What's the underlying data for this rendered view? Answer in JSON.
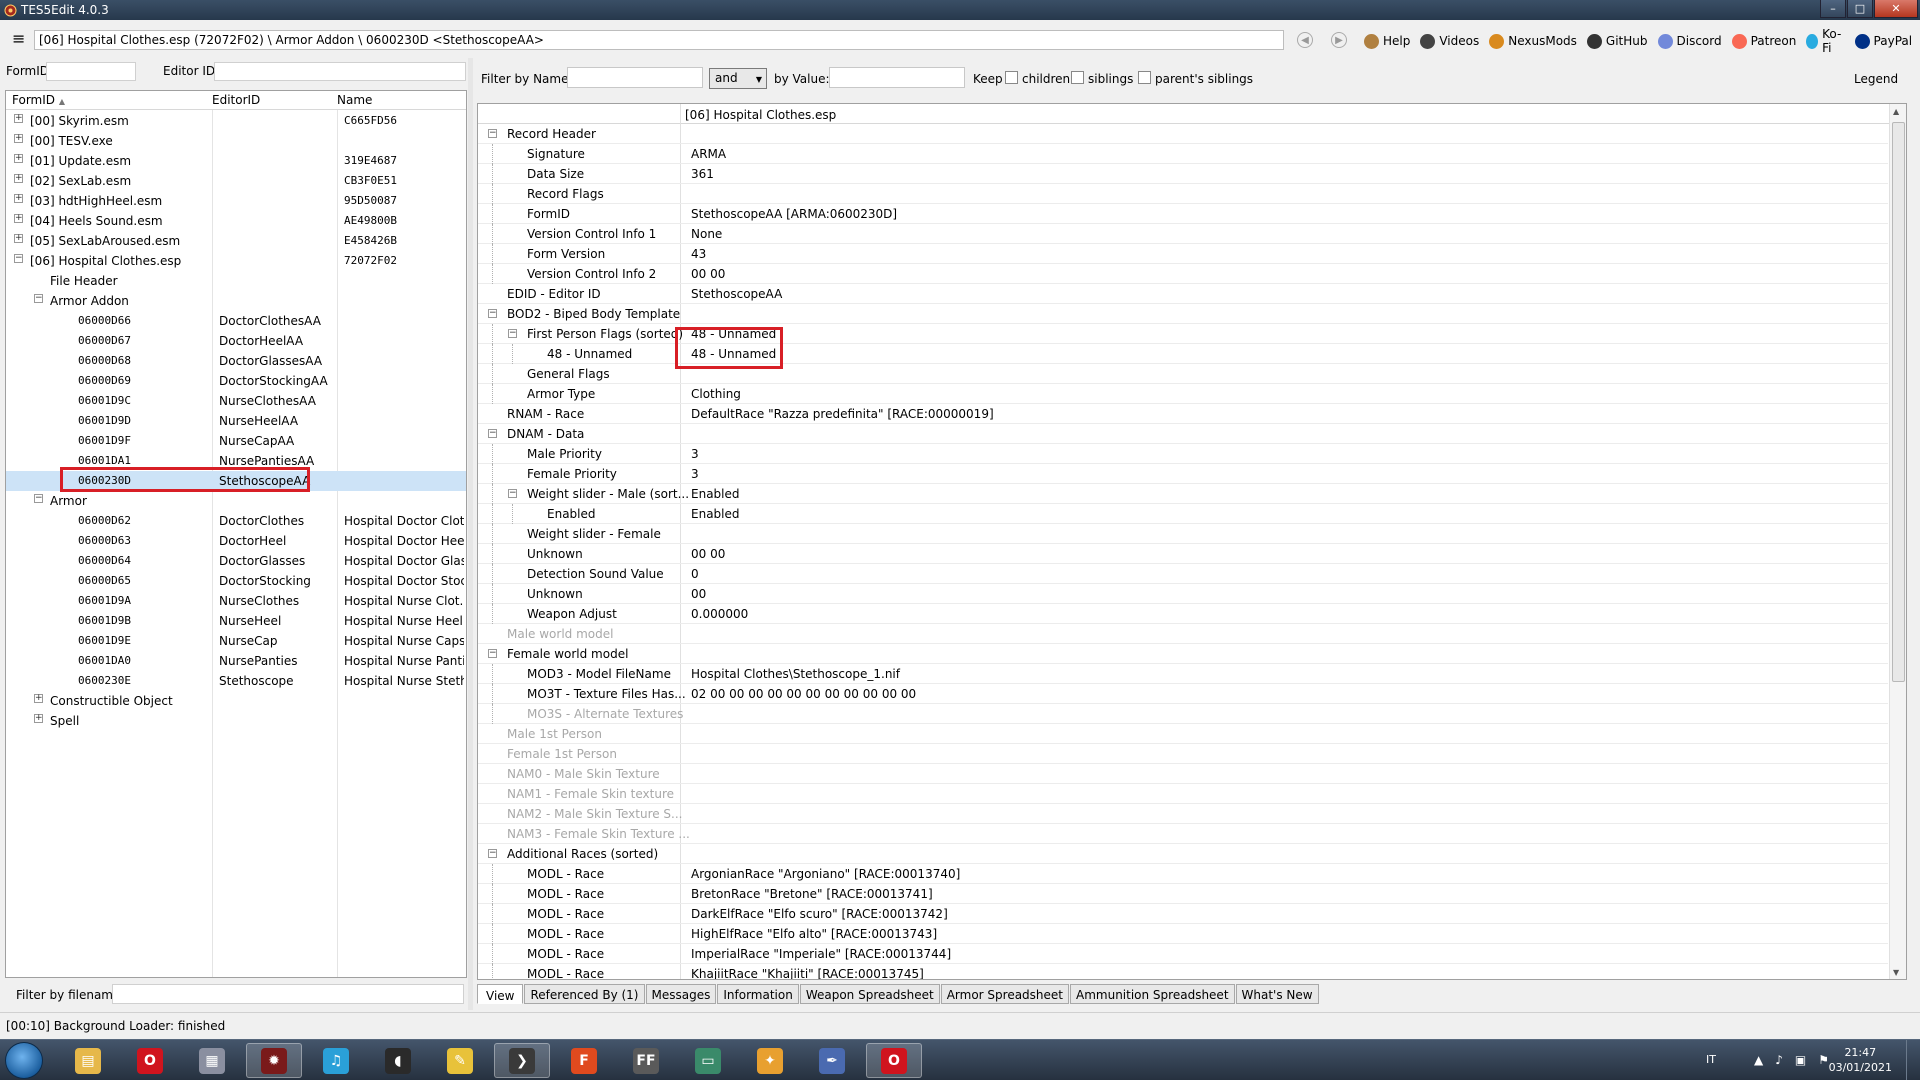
{
  "window": {
    "title": "TES5Edit 4.0.3",
    "min": "–",
    "max": "□",
    "close": "✕"
  },
  "path": {
    "text": "[06] Hospital Clothes.esp (72072F02) \\ Armor Addon \\ 0600230D <StethoscopeAA>"
  },
  "toplinks": [
    {
      "label": "Help",
      "icon": "book-icon",
      "color": "#b08040"
    },
    {
      "label": "Videos",
      "icon": "film-reel-icon",
      "color": "#444444"
    },
    {
      "label": "NexusMods",
      "icon": "nexus-icon",
      "color": "#d98a1e"
    },
    {
      "label": "GitHub",
      "icon": "octocat-icon",
      "color": "#333333"
    },
    {
      "label": "Discord",
      "icon": "discord-icon",
      "color": "#7289da"
    },
    {
      "label": "Patreon",
      "icon": "patreon-icon",
      "color": "#f96854"
    },
    {
      "label": "Ko-Fi",
      "icon": "kofi-icon",
      "color": "#29abe0"
    },
    {
      "label": "PayPal",
      "icon": "paypal-icon",
      "color": "#003087"
    }
  ],
  "left_filter": {
    "formid_label": "FormID",
    "editorid_label": "Editor ID"
  },
  "left_tree": {
    "headers": {
      "formid": "FormID",
      "editorid": "EditorID",
      "name": "Name"
    },
    "rows": [
      {
        "indent": 0,
        "exp": "+",
        "c1": "[00] Skyrim.esm",
        "c2": "",
        "c3": "C665FD56"
      },
      {
        "indent": 0,
        "exp": "+",
        "c1": "[00] TESV.exe",
        "c2": "",
        "c3": ""
      },
      {
        "indent": 0,
        "exp": "+",
        "c1": "[01] Update.esm",
        "c2": "",
        "c3": "319E4687"
      },
      {
        "indent": 0,
        "exp": "+",
        "c1": "[02] SexLab.esm",
        "c2": "",
        "c3": "CB3F0E51"
      },
      {
        "indent": 0,
        "exp": "+",
        "c1": "[03] hdtHighHeel.esm",
        "c2": "",
        "c3": "95D50087"
      },
      {
        "indent": 0,
        "exp": "+",
        "c1": "[04] Heels Sound.esm",
        "c2": "",
        "c3": "AE49800B"
      },
      {
        "indent": 0,
        "exp": "+",
        "c1": "[05] SexLabAroused.esm",
        "c2": "",
        "c3": "E458426B"
      },
      {
        "indent": 0,
        "exp": "−",
        "c1": "[06] Hospital Clothes.esp",
        "c2": "",
        "c3": "72072F02"
      },
      {
        "indent": 1,
        "exp": "",
        "c1": "File Header",
        "c2": "",
        "c3": ""
      },
      {
        "indent": 1,
        "exp": "−",
        "c1": "Armor Addon",
        "c2": "",
        "c3": ""
      },
      {
        "indent": 2,
        "exp": "",
        "c1": "06000D66",
        "c2": "DoctorClothesAA",
        "c3": "",
        "mono": true
      },
      {
        "indent": 2,
        "exp": "",
        "c1": "06000D67",
        "c2": "DoctorHeelAA",
        "c3": "",
        "mono": true
      },
      {
        "indent": 2,
        "exp": "",
        "c1": "06000D68",
        "c2": "DoctorGlassesAA",
        "c3": "",
        "mono": true
      },
      {
        "indent": 2,
        "exp": "",
        "c1": "06000D69",
        "c2": "DoctorStockingAA",
        "c3": "",
        "mono": true
      },
      {
        "indent": 2,
        "exp": "",
        "c1": "06001D9C",
        "c2": "NurseClothesAA",
        "c3": "",
        "mono": true
      },
      {
        "indent": 2,
        "exp": "",
        "c1": "06001D9D",
        "c2": "NurseHeelAA",
        "c3": "",
        "mono": true
      },
      {
        "indent": 2,
        "exp": "",
        "c1": "06001D9F",
        "c2": "NurseCapAA",
        "c3": "",
        "mono": true
      },
      {
        "indent": 2,
        "exp": "",
        "c1": "06001DA1",
        "c2": "NursePantiesAA",
        "c3": "",
        "mono": true
      },
      {
        "indent": 2,
        "exp": "",
        "c1": "0600230D",
        "c2": "StethoscopeAA",
        "c3": "",
        "mono": true,
        "selected": true
      },
      {
        "indent": 1,
        "exp": "−",
        "c1": "Armor",
        "c2": "",
        "c3": ""
      },
      {
        "indent": 2,
        "exp": "",
        "c1": "06000D62",
        "c2": "DoctorClothes",
        "c3": "Hospital Doctor Clot...",
        "mono": true
      },
      {
        "indent": 2,
        "exp": "",
        "c1": "06000D63",
        "c2": "DoctorHeel",
        "c3": "Hospital Doctor Heel",
        "mono": true
      },
      {
        "indent": 2,
        "exp": "",
        "c1": "06000D64",
        "c2": "DoctorGlasses",
        "c3": "Hospital Doctor Glas...",
        "mono": true
      },
      {
        "indent": 2,
        "exp": "",
        "c1": "06000D65",
        "c2": "DoctorStocking",
        "c3": "Hospital Doctor Stoc...",
        "mono": true
      },
      {
        "indent": 2,
        "exp": "",
        "c1": "06001D9A",
        "c2": "NurseClothes",
        "c3": "Hospital Nurse Clot...",
        "mono": true
      },
      {
        "indent": 2,
        "exp": "",
        "c1": "06001D9B",
        "c2": "NurseHeel",
        "c3": "Hospital Nurse Heel",
        "mono": true
      },
      {
        "indent": 2,
        "exp": "",
        "c1": "06001D9E",
        "c2": "NurseCap",
        "c3": "Hospital Nurse Caps",
        "mono": true
      },
      {
        "indent": 2,
        "exp": "",
        "c1": "06001DA0",
        "c2": "NursePanties",
        "c3": "Hospital Nurse Panti...",
        "mono": true
      },
      {
        "indent": 2,
        "exp": "",
        "c1": "0600230E",
        "c2": "Stethoscope",
        "c3": "Hospital Nurse Steth...",
        "mono": true
      },
      {
        "indent": 1,
        "exp": "+",
        "c1": "Constructible Object",
        "c2": "",
        "c3": ""
      },
      {
        "indent": 1,
        "exp": "+",
        "c1": "Spell",
        "c2": "",
        "c3": ""
      }
    ]
  },
  "left_bottom": {
    "label": "Filter by filename:"
  },
  "right_filter": {
    "filter_name_label": "Filter by Name:",
    "and_value": "and",
    "by_value_label": "by Value:",
    "keep_label": "Keep",
    "children_label": "children",
    "siblings_label": "siblings",
    "parents_siblings_label": "parent's siblings",
    "legend_label": "Legend"
  },
  "record": {
    "header": "[06] Hospital Clothes.esp",
    "rows": [
      {
        "lvl": 0,
        "exp": "−",
        "label": "Record Header",
        "value": ""
      },
      {
        "lvl": 1,
        "exp": "",
        "label": "Signature",
        "value": "ARMA"
      },
      {
        "lvl": 1,
        "exp": "",
        "label": "Data Size",
        "value": "361"
      },
      {
        "lvl": 1,
        "exp": "",
        "label": "Record Flags",
        "value": ""
      },
      {
        "lvl": 1,
        "exp": "",
        "label": "FormID",
        "value": "StethoscopeAA [ARMA:0600230D]"
      },
      {
        "lvl": 1,
        "exp": "",
        "label": "Version Control Info 1",
        "value": "None"
      },
      {
        "lvl": 1,
        "exp": "",
        "label": "Form Version",
        "value": "43"
      },
      {
        "lvl": 1,
        "exp": "",
        "label": "Version Control Info 2",
        "value": "00 00"
      },
      {
        "lvl": 0,
        "exp": "",
        "label": "EDID - Editor ID",
        "value": "StethoscopeAA"
      },
      {
        "lvl": 0,
        "exp": "−",
        "label": "BOD2 - Biped Body Template",
        "value": ""
      },
      {
        "lvl": 1,
        "exp": "−",
        "label": "First Person Flags (sorted)",
        "value": "48 - Unnamed"
      },
      {
        "lvl": 2,
        "exp": "",
        "label": "48 - Unnamed",
        "value": "48 - Unnamed"
      },
      {
        "lvl": 1,
        "exp": "",
        "label": "General Flags",
        "value": ""
      },
      {
        "lvl": 1,
        "exp": "",
        "label": "Armor Type",
        "value": "Clothing"
      },
      {
        "lvl": 0,
        "exp": "",
        "label": "RNAM - Race",
        "value": "DefaultRace \"Razza predefinita\" [RACE:00000019]"
      },
      {
        "lvl": 0,
        "exp": "−",
        "label": "DNAM - Data",
        "value": ""
      },
      {
        "lvl": 1,
        "exp": "",
        "label": "Male Priority",
        "value": "3"
      },
      {
        "lvl": 1,
        "exp": "",
        "label": "Female Priority",
        "value": "3"
      },
      {
        "lvl": 1,
        "exp": "−",
        "label": "Weight slider - Male (sort...",
        "value": "Enabled"
      },
      {
        "lvl": 2,
        "exp": "",
        "label": "Enabled",
        "value": "Enabled"
      },
      {
        "lvl": 1,
        "exp": "",
        "label": "Weight slider - Female",
        "value": ""
      },
      {
        "lvl": 1,
        "exp": "",
        "label": "Unknown",
        "value": "00 00"
      },
      {
        "lvl": 1,
        "exp": "",
        "label": "Detection Sound Value",
        "value": "0"
      },
      {
        "lvl": 1,
        "exp": "",
        "label": "Unknown",
        "value": "00"
      },
      {
        "lvl": 1,
        "exp": "",
        "label": "Weapon Adjust",
        "value": "0.000000"
      },
      {
        "lvl": 0,
        "exp": "",
        "label": "Male world model",
        "value": "",
        "dim": true
      },
      {
        "lvl": 0,
        "exp": "−",
        "label": "Female world model",
        "value": ""
      },
      {
        "lvl": 1,
        "exp": "",
        "label": "MOD3 - Model FileName",
        "value": "Hospital Clothes\\Stethoscope_1.nif"
      },
      {
        "lvl": 1,
        "exp": "",
        "label": "MO3T - Texture Files Has...",
        "value": "02 00 00 00 00 00 00 00 00 00 00 00"
      },
      {
        "lvl": 1,
        "exp": "",
        "label": "MO3S - Alternate Textures",
        "value": "",
        "dim": true
      },
      {
        "lvl": 0,
        "exp": "",
        "label": "Male 1st Person",
        "value": "",
        "dim": true
      },
      {
        "lvl": 0,
        "exp": "",
        "label": "Female 1st Person",
        "value": "",
        "dim": true
      },
      {
        "lvl": 0,
        "exp": "",
        "label": "NAM0 - Male Skin Texture",
        "value": "",
        "dim": true
      },
      {
        "lvl": 0,
        "exp": "",
        "label": "NAM1 - Female Skin texture",
        "value": "",
        "dim": true
      },
      {
        "lvl": 0,
        "exp": "",
        "label": "NAM2 - Male Skin Texture S...",
        "value": "",
        "dim": true
      },
      {
        "lvl": 0,
        "exp": "",
        "label": "NAM3 - Female Skin Texture ...",
        "value": "",
        "dim": true
      },
      {
        "lvl": 0,
        "exp": "−",
        "label": "Additional Races (sorted)",
        "value": ""
      },
      {
        "lvl": 1,
        "exp": "",
        "label": "MODL - Race",
        "value": "ArgonianRace \"Argoniano\" [RACE:00013740]"
      },
      {
        "lvl": 1,
        "exp": "",
        "label": "MODL - Race",
        "value": "BretonRace \"Bretone\" [RACE:00013741]"
      },
      {
        "lvl": 1,
        "exp": "",
        "label": "MODL - Race",
        "value": "DarkElfRace \"Elfo scuro\" [RACE:00013742]"
      },
      {
        "lvl": 1,
        "exp": "",
        "label": "MODL - Race",
        "value": "HighElfRace \"Elfo alto\" [RACE:00013743]"
      },
      {
        "lvl": 1,
        "exp": "",
        "label": "MODL - Race",
        "value": "ImperialRace \"Imperiale\" [RACE:00013744]"
      },
      {
        "lvl": 1,
        "exp": "",
        "label": "MODL - Race",
        "value": "KhajiitRace \"Khajiiti\" [RACE:00013745]"
      }
    ]
  },
  "tabs": [
    "View",
    "Referenced By (1)",
    "Messages",
    "Information",
    "Weapon Spreadsheet",
    "Armor Spreadsheet",
    "Ammunition Spreadsheet",
    "What's New"
  ],
  "status": {
    "text": "[00:10] Background Loader: finished"
  },
  "taskbar": {
    "apps": [
      {
        "icon": "explorer-folder-icon",
        "glyph": "▤",
        "color": "#e6b84a"
      },
      {
        "icon": "opera-icon",
        "glyph": "O",
        "color": "#d0141e"
      },
      {
        "icon": "calculator-icon",
        "glyph": "▦",
        "color": "#8a8fa0"
      },
      {
        "icon": "tes5edit-icon",
        "glyph": "✹",
        "color": "#7a1a1a",
        "active": true
      },
      {
        "icon": "music-player-icon",
        "glyph": "♫",
        "color": "#2aa0d8"
      },
      {
        "icon": "audio-tool-icon",
        "glyph": "◖",
        "color": "#2a2a2a"
      },
      {
        "icon": "notes-icon",
        "glyph": "✎",
        "color": "#e8c23a"
      },
      {
        "icon": "arrow-app-icon",
        "glyph": "❯",
        "color": "#3a3a3a",
        "active": true
      },
      {
        "icon": "f-app-icon",
        "glyph": "F",
        "color": "#e04a1e"
      },
      {
        "icon": "ffdec-icon",
        "glyph": "FF",
        "color": "#5a5a5a"
      },
      {
        "icon": "document-viewer-icon",
        "glyph": "▭",
        "color": "#3a8a6a"
      },
      {
        "icon": "pinwheel-icon",
        "glyph": "✦",
        "color": "#e8a030"
      },
      {
        "icon": "feather-icon",
        "glyph": "✒",
        "color": "#4a6ab0"
      },
      {
        "icon": "opera-icon-2",
        "glyph": "O",
        "color": "#d0141e",
        "active": true
      }
    ],
    "tray": {
      "lang": "IT",
      "time": "21:47",
      "date": "03/01/2021"
    }
  }
}
